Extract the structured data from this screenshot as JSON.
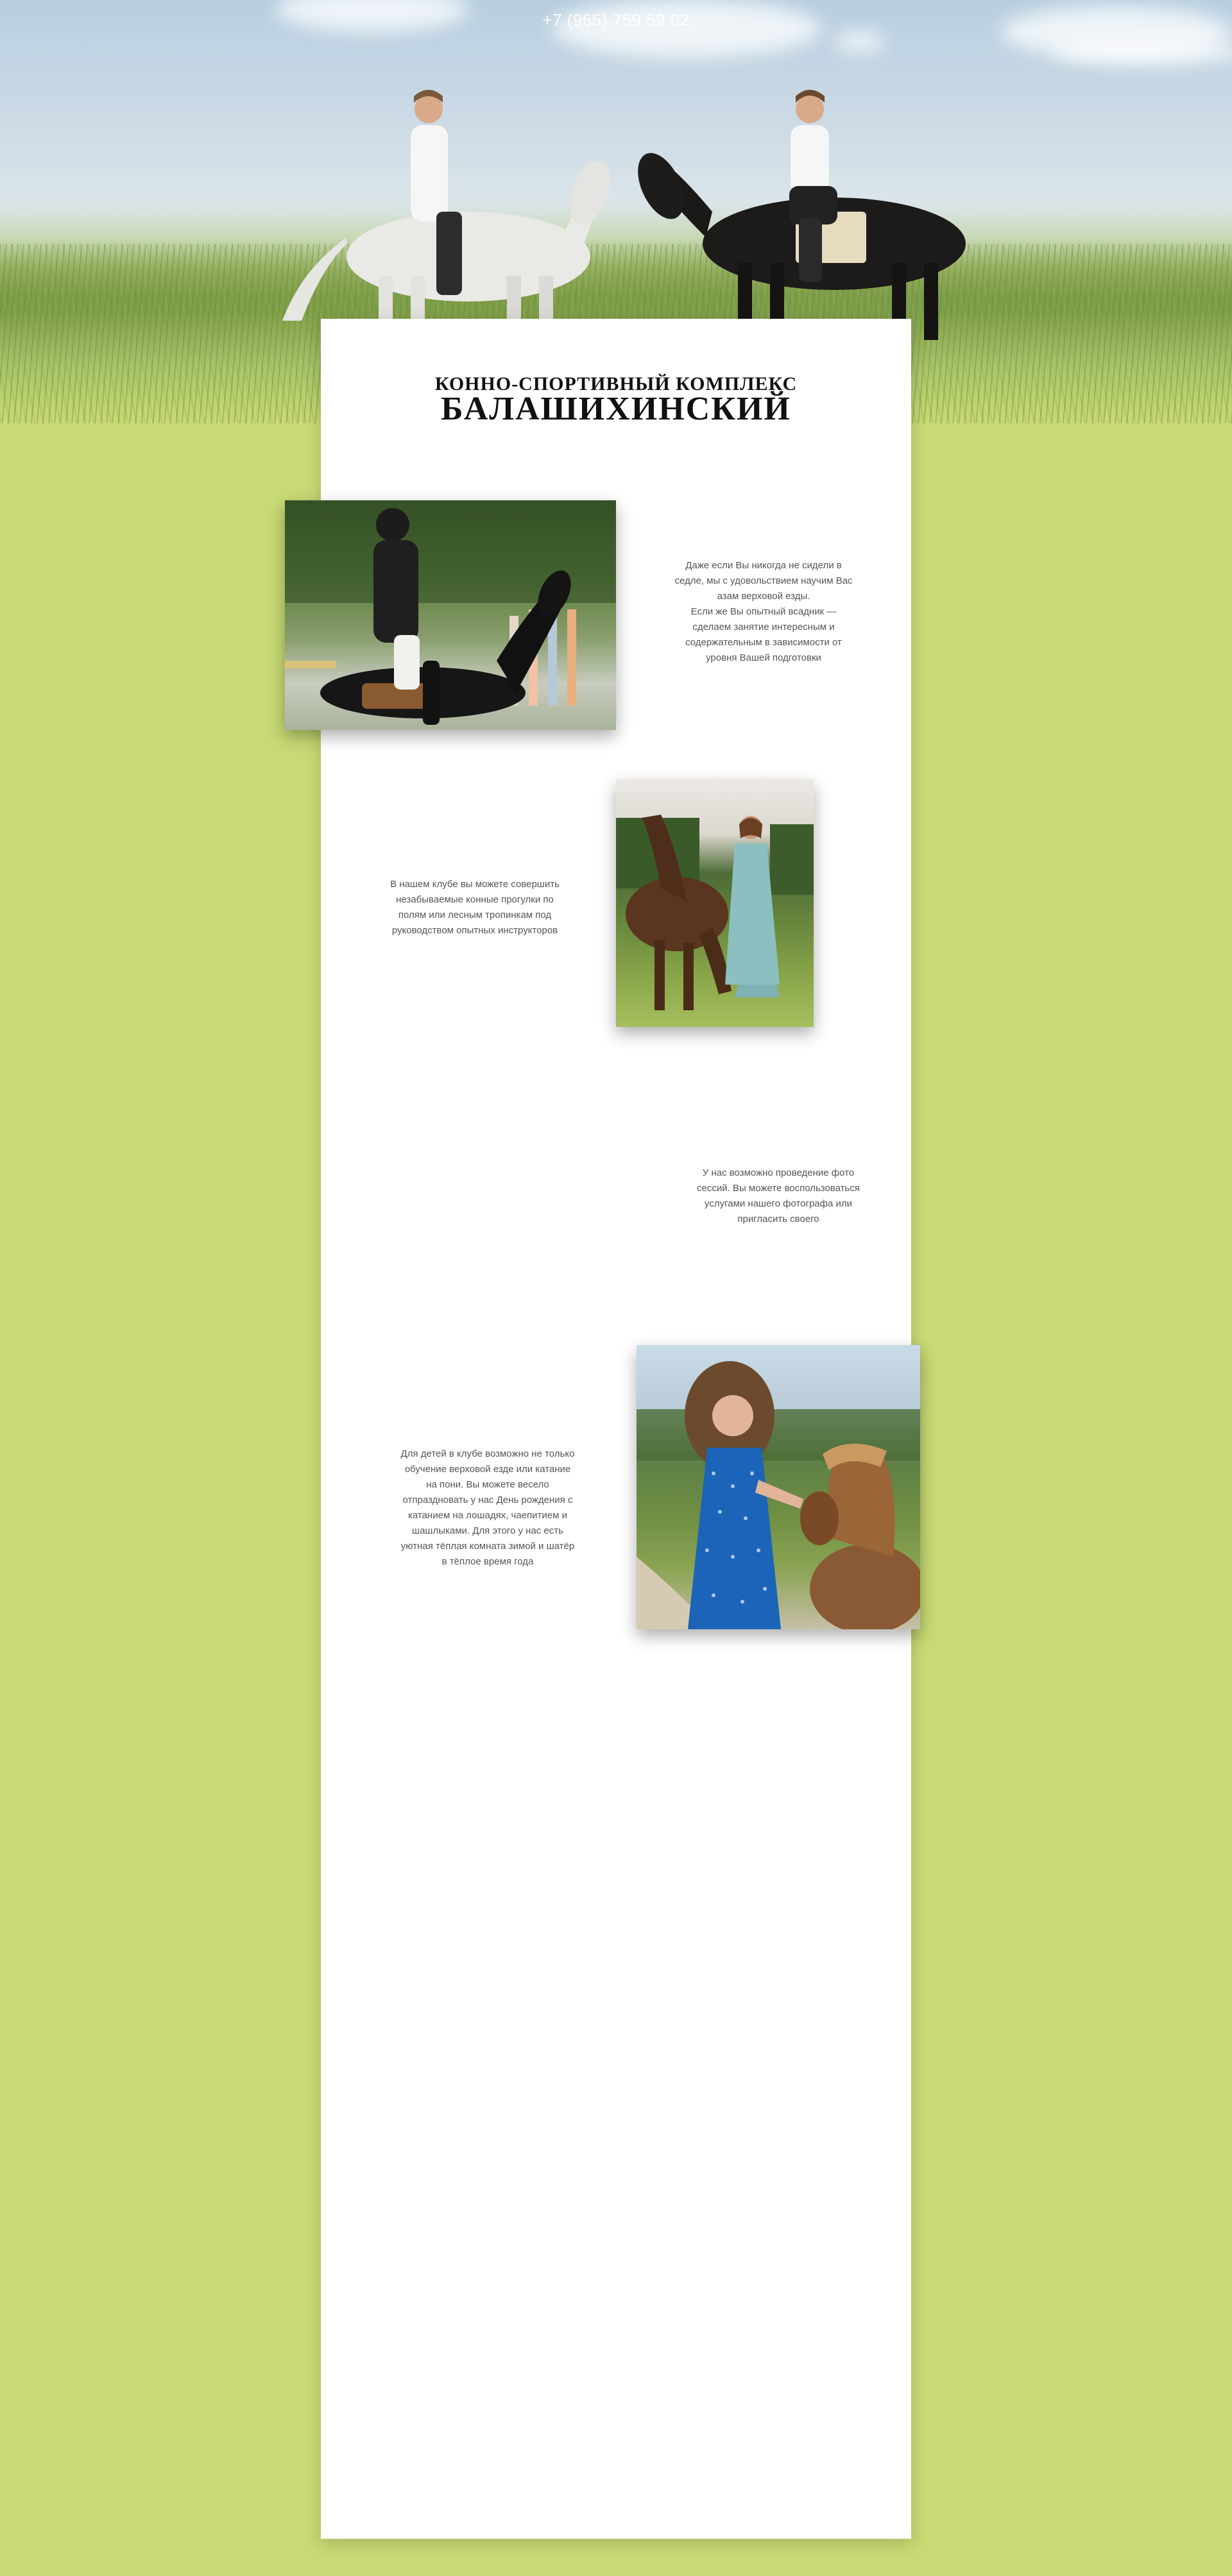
{
  "header": {
    "phone": "+7 (965) 759 59 02"
  },
  "hero": {
    "title_small": "КОННО-СПОРТИВНЫЙ КОМПЛЕКС",
    "title_big": "БАЛАШИХИНСКИЙ"
  },
  "sections": [
    {
      "text_lines": [
        "Даже если Вы никогда не сидели в",
        "седле, мы с удовольствием научим Вас",
        "азам верховой езды.",
        "Если же Вы опытный всадник —",
        "сделаем занятие интересным и",
        "содержательным в зависимости от",
        "уровня Вашей подготовки"
      ]
    },
    {
      "text_lines": [
        "В нашем клубе вы можете совершить",
        "незабываемые конные прогулки по",
        "полям или лесным тропинкам под",
        "руководством опытных инструкторов"
      ]
    },
    {
      "text_lines": [
        "У нас возможно проведение фото",
        "сессий. Вы можете воспользоваться",
        "услугами нашего фотографа или",
        "пригласить своего"
      ]
    },
    {
      "text_lines": [
        "Для детей в клубе возможно не только",
        "обучение верховой езде или катание",
        "на пони. Вы можете весело",
        "отпраздновать у нас День рождения с",
        "катанием на лошадях, чаепитием и",
        "шашлыками. Для этого у нас есть",
        "уютная тёплая комната зимой и шатёр",
        "в тёплое время года"
      ]
    }
  ],
  "colors": {
    "background": "#c8da74",
    "card": "#ffffff",
    "text": "#555555",
    "title": "#111111"
  },
  "icons": [
    "phone-number",
    "hero-photo",
    "rider-photo",
    "horse-woman-photo",
    "pony-girl-photo"
  ]
}
